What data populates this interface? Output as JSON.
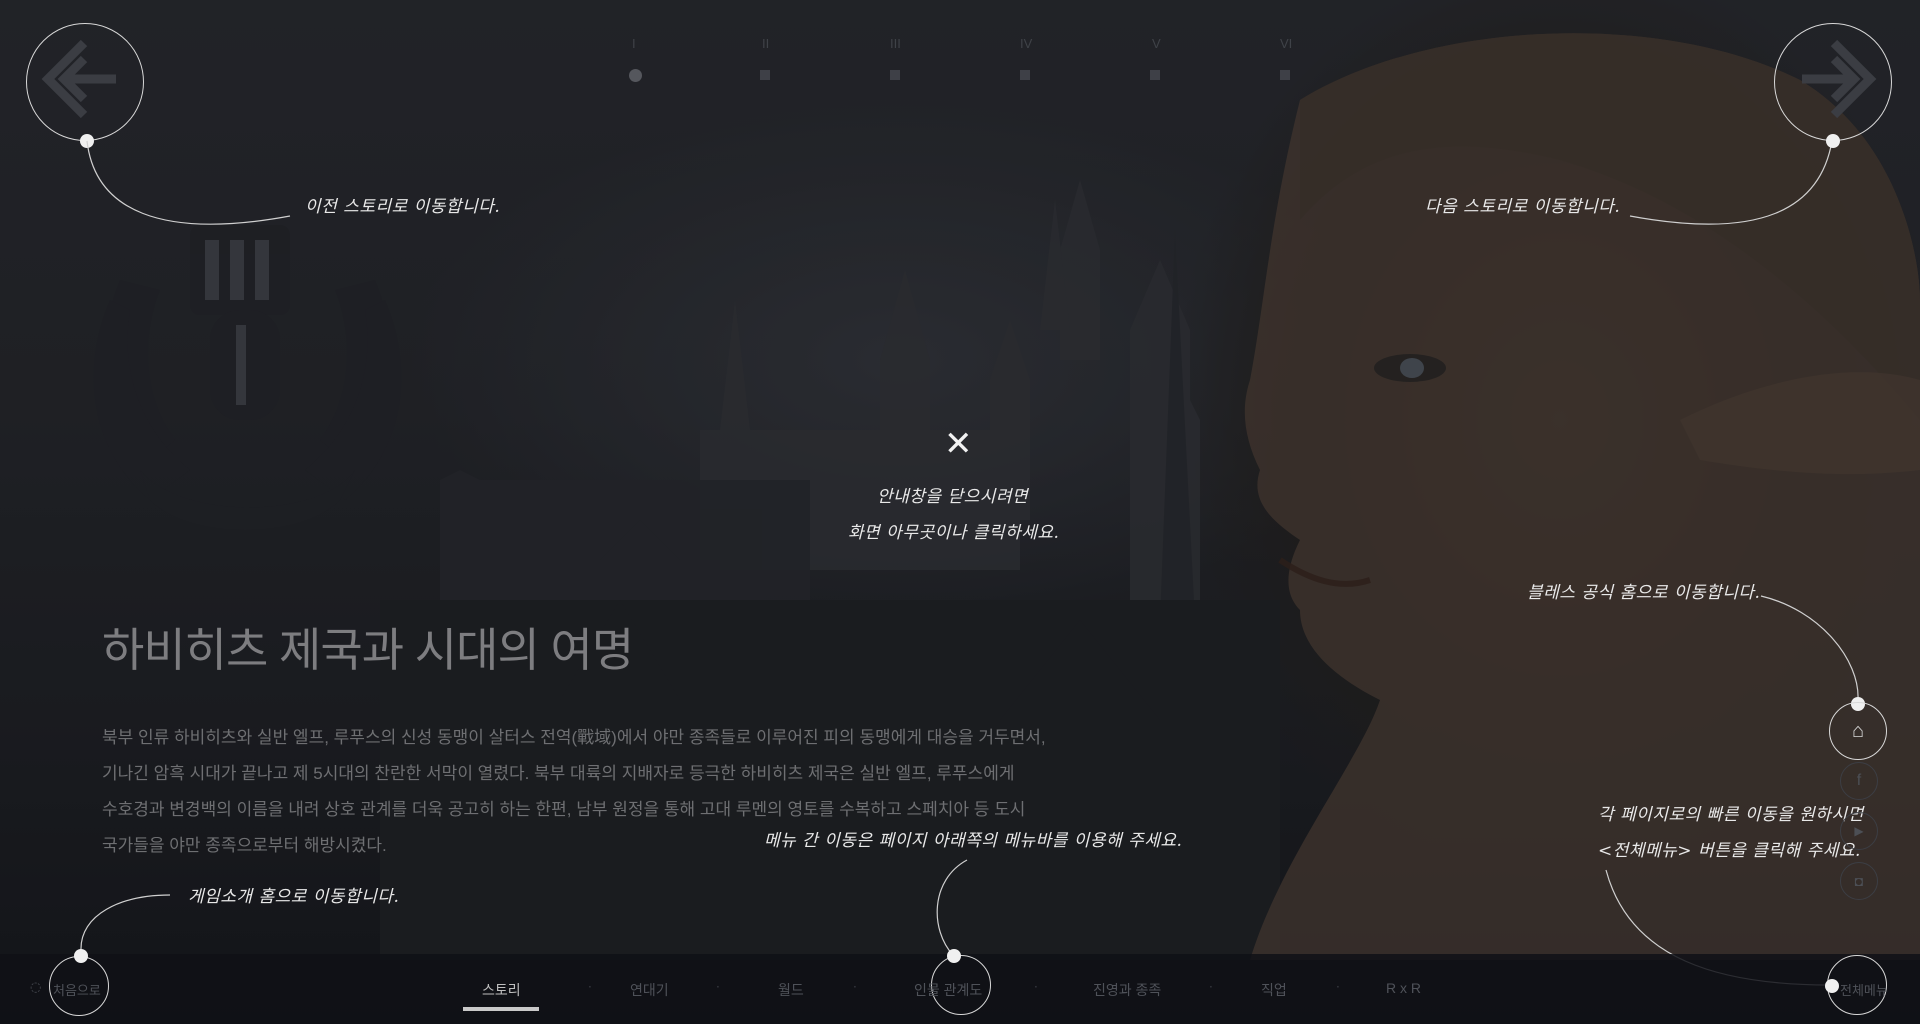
{
  "timeline": {
    "labels": [
      "I",
      "II",
      "III",
      "IV",
      "V",
      "VI"
    ],
    "active_index": 0
  },
  "nav": {
    "prev_hint": "이전 스토리로 이동합니다.",
    "next_hint": "다음 스토리로 이동합니다."
  },
  "overlay": {
    "close_line1": "안내창을 닫으시려면",
    "close_line2": "화면 아무곳이나 클릭하세요.",
    "menu_hint": "메뉴 간 이동은 페이지 아래쪽의 메뉴바를 이용해 주세요.",
    "home_hint": "블레스 공식 홈으로 이동합니다.",
    "allmenu_line1": "각 페이지로의 빠른 이동을 원하시면",
    "allmenu_line2": "<전체메뉴> 버튼을 클릭해 주세요.",
    "game_home_hint": "게임소개 홈으로 이동합니다."
  },
  "content": {
    "title": "하비히츠 제국과 시대의 여명",
    "paragraph": [
      "북부 인류 하비히츠와 실반 엘프, 루푸스의 신성 동맹이 살터스 전역(戰域)에서 야만 종족들로 이루어진 피의 동맹에게 대승을 거두면서,",
      "기나긴 암흑 시대가 끝나고 제 5시대의 찬란한 서막이 열렸다. 북부 대륙의 지배자로 등극한 하비히츠 제국은 실반 엘프, 루푸스에게",
      "수호경과 변경백의 이름을 내려 상호 관계를 더욱 공고히 하는 한편, 남부 원정을 통해 고대 루멘의 영토를 수복하고 스페치아 등 도시",
      "국가들을 야만 종족으로부터 해방시켰다."
    ]
  },
  "footer": {
    "first_label": "처음으로",
    "menu": [
      "스토리",
      "연대기",
      "월드",
      "인물 관계도",
      "진영과 종족",
      "직업",
      "R x R"
    ],
    "active_index": 0,
    "all_menu_label": "전체메뉴"
  },
  "side": {
    "items": [
      "home-icon",
      "facebook-icon",
      "youtube-icon",
      "instagram-icon"
    ]
  },
  "colors": {
    "accent": "#e9e9e9",
    "muted": "#6e6f72"
  }
}
